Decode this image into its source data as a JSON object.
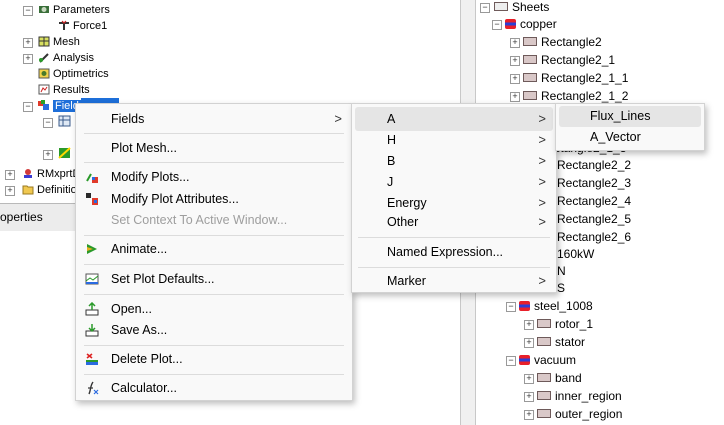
{
  "left_tree": {
    "items": [
      {
        "label": "Parameters"
      },
      {
        "label": "Force1"
      },
      {
        "label": "Mesh"
      },
      {
        "label": "Analysis"
      },
      {
        "label": "Optimetrics"
      },
      {
        "label": "Results"
      },
      {
        "label": "Field"
      },
      {
        "label": "RMxprtD"
      },
      {
        "label": "Definitio"
      }
    ]
  },
  "properties_header": "operties",
  "right_tree": {
    "items": [
      {
        "label": "Sheets"
      },
      {
        "label": "copper"
      },
      {
        "label": "Rectangle2"
      },
      {
        "label": "Rectangle2_1"
      },
      {
        "label": "Rectangle2_1_1"
      },
      {
        "label": "Rectangle2_1_2"
      },
      {
        "label": "Rectangle2_1_3"
      },
      {
        "label": "Rectangle2_2"
      },
      {
        "label": "Rectangle2_3"
      },
      {
        "label": "Rectangle2_4"
      },
      {
        "label": "Rectangle2_5"
      },
      {
        "label": "Rectangle2_6"
      },
      {
        "label": "160kW"
      },
      {
        "label": "N"
      },
      {
        "label": "S"
      },
      {
        "label": "steel_1008"
      },
      {
        "label": "rotor_1"
      },
      {
        "label": "stator"
      },
      {
        "label": "vacuum"
      },
      {
        "label": "band"
      },
      {
        "label": "inner_region"
      },
      {
        "label": "outer_region"
      }
    ]
  },
  "context_menu": {
    "items": [
      {
        "label": "Fields",
        "icon": "none",
        "submenu": true
      },
      {
        "label": "Plot Mesh...",
        "icon": "none"
      },
      {
        "label": "Modify Plots...",
        "icon": "modify-plots-icon"
      },
      {
        "label": "Modify Plot Attributes...",
        "icon": "plot-attributes-icon"
      },
      {
        "label": "Set Context To Active Window...",
        "icon": "none",
        "disabled": true
      },
      {
        "label": "Animate...",
        "icon": "animate-icon"
      },
      {
        "label": "Set Plot Defaults...",
        "icon": "plot-defaults-icon"
      },
      {
        "label": "Open...",
        "icon": "open-icon"
      },
      {
        "label": "Save As...",
        "icon": "save-as-icon"
      },
      {
        "label": "Delete Plot...",
        "icon": "delete-plot-icon"
      },
      {
        "label": "Calculator...",
        "icon": "calculator-icon"
      }
    ]
  },
  "fields_menu": {
    "items": [
      {
        "label": "A",
        "submenu": true
      },
      {
        "label": "H",
        "submenu": true
      },
      {
        "label": "B",
        "submenu": true
      },
      {
        "label": "J",
        "submenu": true
      },
      {
        "label": "Energy",
        "submenu": true
      },
      {
        "label": "Other",
        "submenu": true
      },
      {
        "label": "Named Expression...",
        "submenu": false
      },
      {
        "label": "Marker",
        "submenu": true
      }
    ]
  },
  "a_menu": {
    "items": [
      {
        "label": "Flux_Lines",
        "highlighted": true
      },
      {
        "label": "A_Vector",
        "highlighted": false
      }
    ]
  },
  "arrow_glyph": ">",
  "colors": {
    "menu_bg": "#f9f9f9",
    "highlight": "#e5e5e5",
    "selection": "#1e6fd9",
    "disabled_text": "#9e9e9e"
  }
}
